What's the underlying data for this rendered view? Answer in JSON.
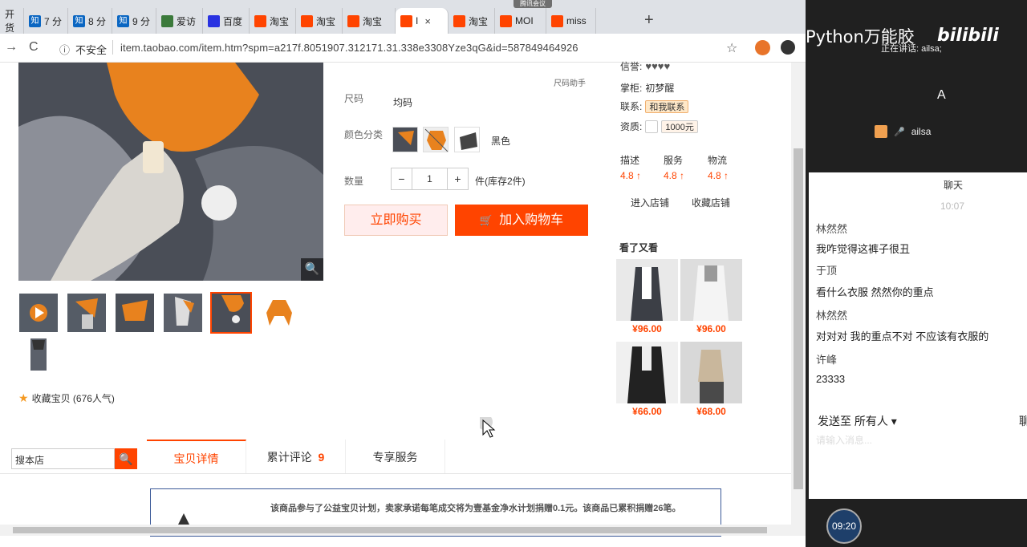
{
  "browser": {
    "meeting_tag": "腾讯会议",
    "tabs": [
      {
        "label": "开货",
        "color": "#e8742a"
      },
      {
        "label": "7 分",
        "color": "#0a66c2",
        "icon": "知"
      },
      {
        "label": "8 分",
        "color": "#0a66c2",
        "icon": "知"
      },
      {
        "label": "9 分",
        "color": "#0a66c2",
        "icon": "知"
      },
      {
        "label": "爱访",
        "color": "#3b7a3b"
      },
      {
        "label": "百度",
        "color": "#2932e1"
      },
      {
        "label": "淘宝",
        "color": "#f40"
      },
      {
        "label": "淘宝",
        "color": "#f40"
      },
      {
        "label": "淘宝",
        "color": "#f40"
      },
      {
        "label": "I",
        "color": "#f40"
      },
      {
        "label": "淘宝",
        "color": "#f40"
      },
      {
        "label": "MOI",
        "color": "#f40"
      },
      {
        "label": "miss",
        "color": "#f40"
      }
    ],
    "tab_close": "×",
    "new_tab": "+",
    "win_min": "—",
    "win_max": "☐",
    "win_close": "✕",
    "nav_back": "→",
    "nav_reload": "C",
    "info_icon": "ⓘ",
    "insecure": "不安全",
    "url": "item.taobao.com/item.htm?spm=a217f.8051907.312171.31.338e3308Yze3qG&id=587849464926",
    "star": "☆"
  },
  "product": {
    "size_help": "尺码助手",
    "size_label": "尺码",
    "size_value": "均码",
    "color_label": "颜色分类",
    "color_black": "黑色",
    "qty_label": "数量",
    "qty_minus": "−",
    "qty_value": "1",
    "qty_plus": "+",
    "qty_stock": "件(库存2件)",
    "buy_now": "立即购买",
    "add_cart": "加入购物车",
    "cart_icon": "🛒",
    "zoom_icon": "🔍",
    "fav_star": "★",
    "fav_text": "收藏宝贝 (676人气)"
  },
  "shop": {
    "credit_label": "信誉:",
    "credit_hearts": "♥♥♥♥",
    "owner_label": "掌柜:",
    "owner_name": "初梦醒",
    "contact_label": "联系:",
    "contact_btn": "和我联系",
    "qual_label": "资质:",
    "deposit": "1000元",
    "ratings": [
      {
        "label": "描述",
        "value": "4.8 ↑"
      },
      {
        "label": "服务",
        "value": "4.8 ↑"
      },
      {
        "label": "物流",
        "value": "4.8 ↑"
      }
    ],
    "enter_shop": "进入店铺",
    "collect_shop": "收藏店铺",
    "see_also": "看了又看",
    "recs": [
      {
        "price": "¥96.00"
      },
      {
        "price": "¥96.00"
      },
      {
        "price": "¥66.00"
      },
      {
        "price": "¥68.00"
      }
    ]
  },
  "page_tabs": {
    "search_placeholder": "搜本店",
    "search_icon": "🔍",
    "tabs": [
      {
        "label": "宝贝详情"
      },
      {
        "label": "累计评论",
        "count": "9"
      },
      {
        "label": "专享服务"
      }
    ],
    "notice": "该商品参与了公益宝贝计划，卖家承诺每笔成交将为壹基金净水计划捐赠0.1元。该商品已累积捐赠26笔。"
  },
  "meeting": {
    "brand": "Python万能胶",
    "bili": "bilibili",
    "speaking": "正在讲话: ailsa;",
    "avatar_letter": "A",
    "user": "ailsa",
    "mic": "🎤",
    "chat_title": "聊天",
    "chat_time": "10:07",
    "messages": [
      {
        "text": "林然然",
        "type": "name"
      },
      {
        "text": "我咋觉得这裤子很丑",
        "type": "msg"
      },
      {
        "text": "于顶",
        "type": "name"
      },
      {
        "text": "看什么衣服  然然你的重点",
        "type": "msg"
      },
      {
        "text": "林然然",
        "type": "name"
      },
      {
        "text": "对对对 我的重点不对 不应该有衣服的",
        "type": "msg"
      },
      {
        "text": "许峰",
        "type": "name"
      },
      {
        "text": "23333",
        "type": "msg"
      }
    ],
    "send_to": "发送至 所有人 ▾",
    "send_to_extra": "聊",
    "input_placeholder": "请输入消息...",
    "timer": "09:20"
  }
}
